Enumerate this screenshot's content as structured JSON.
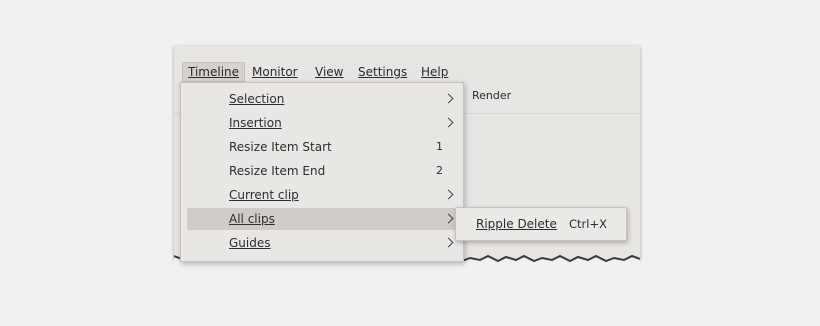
{
  "menubar": {
    "items": [
      {
        "id": "timeline",
        "label": "Timeline",
        "active": true
      },
      {
        "id": "monitor",
        "label": "Monitor"
      },
      {
        "id": "view",
        "label": "View"
      },
      {
        "id": "settings",
        "label": "Settings"
      },
      {
        "id": "help",
        "label": "Help"
      }
    ]
  },
  "toolbar": {
    "render_label": "Render"
  },
  "timeline_menu": {
    "items": [
      {
        "label": "Selection",
        "shortcut": "",
        "submenu": true
      },
      {
        "label": "Insertion",
        "shortcut": "",
        "submenu": true
      },
      {
        "label": "Resize Item Start",
        "shortcut": "1",
        "submenu": false
      },
      {
        "label": "Resize Item End",
        "shortcut": "2",
        "submenu": false
      },
      {
        "label": "Current clip",
        "shortcut": "",
        "submenu": true
      },
      {
        "label": "All clips",
        "shortcut": "",
        "submenu": true,
        "highlighted": true
      },
      {
        "label": "Guides",
        "shortcut": "",
        "submenu": true
      }
    ]
  },
  "all_clips_submenu": {
    "items": [
      {
        "label": "Ripple Delete",
        "shortcut": "Ctrl+X"
      }
    ]
  },
  "colors": {
    "window_bg": "#e7e5e2",
    "menu_bg": "#e9e7e4",
    "highlight": "#cfccc8",
    "page_bg": "#f1f1f1"
  }
}
